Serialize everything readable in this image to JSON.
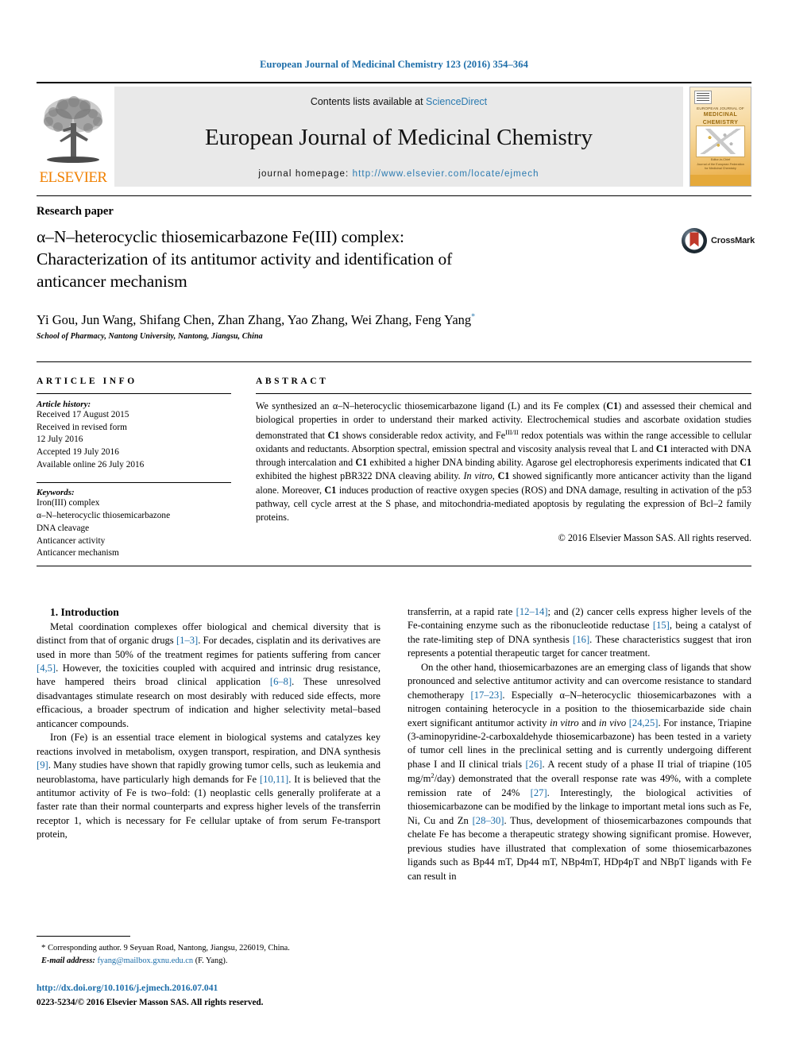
{
  "running_head": "European Journal of Medicinal Chemistry 123 (2016) 354–364",
  "masthead": {
    "publisher_name": "ELSEVIER",
    "contents_prefix": "Contents lists available at ",
    "contents_link": "ScienceDirect",
    "journal_name": "European Journal of Medicinal Chemistry",
    "homepage_prefix": "journal homepage: ",
    "homepage_link": "http://www.elsevier.com/locate/ejmech",
    "cover": {
      "title_top": "EUROPEAN JOURNAL OF",
      "title_main": "MEDICINAL CHEMISTRY",
      "foot_line1": "Editor-in-Chief",
      "foot_line2": "Journal of the European Federation",
      "foot_line3": "for Medicinal Chemistry"
    }
  },
  "article": {
    "type": "Research paper",
    "title_line1": "α–N–heterocyclic thiosemicarbazone Fe(III) complex:",
    "title_line2": "Characterization of its antitumor activity and identification of",
    "title_line3": "anticancer mechanism",
    "crossmark_label": "CrossMark",
    "authors": "Yi Gou, Jun Wang, Shifang Chen, Zhan Zhang, Yao Zhang, Wei Zhang, Feng Yang",
    "author_marker": "*",
    "affiliation": "School of Pharmacy, Nantong University, Nantong, Jiangsu, China"
  },
  "article_info": {
    "heading": "ARTICLE INFO",
    "history_label": "Article history:",
    "history": [
      "Received 17 August 2015",
      "Received in revised form",
      "12 July 2016",
      "Accepted 19 July 2016",
      "Available online 26 July 2016"
    ],
    "keywords_label": "Keywords:",
    "keywords": [
      "Iron(III) complex",
      "α–N–heterocyclic thiosemicarbazone",
      "DNA cleavage",
      "Anticancer activity",
      "Anticancer mechanism"
    ]
  },
  "abstract": {
    "heading": "ABSTRACT",
    "text_part1": "We synthesized an α–N–heterocyclic thiosemicarbazone ligand (L) and its Fe complex (",
    "bold_c1_a": "C1",
    "text_part2": ") and assessed their chemical and biological properties in order to understand their marked activity. Electrochemical studies and ascorbate oxidation studies demonstrated that ",
    "bold_c1_b": "C1",
    "text_part3": " shows considerable redox activity, and Fe",
    "sup_redox": "III/II",
    "text_part4": " redox potentials was within the range accessible to cellular oxidants and reductants. Absorption spectral, emission spectral and viscosity analysis reveal that L and ",
    "bold_c1_c": "C1",
    "text_part5": " interacted with DNA through intercalation and ",
    "bold_c1_d": "C1",
    "text_part6": " exhibited a higher DNA binding ability. Agarose gel electrophoresis experiments indicated that ",
    "bold_c1_e": "C1",
    "text_part7": " exhibited the highest pBR322 DNA cleaving ability. ",
    "italic_invitro": "In vitro",
    "text_part8": ", ",
    "bold_c1_f": "C1",
    "text_part9": " showed significantly more anticancer activity than the ligand alone. Moreover, ",
    "bold_c1_g": "C1",
    "text_part10": " induces production of reactive oxygen species (ROS) and DNA damage, resulting in activation of the p53 pathway, cell cycle arrest at the S phase, and mitochondria-mediated apoptosis by regulating the expression of Bcl–2 family proteins.",
    "copyright": "© 2016 Elsevier Masson SAS. All rights reserved."
  },
  "introduction": {
    "heading": "1. Introduction",
    "left_p1_a": "Metal coordination complexes offer biological and chemical diversity that is distinct from that of organic drugs ",
    "left_p1_ref1": "[1–3]",
    "left_p1_b": ". For decades, cisplatin and its derivatives are used in more than 50% of the treatment regimes for patients suffering from cancer ",
    "left_p1_ref2": "[4,5]",
    "left_p1_c": ". However, the toxicities coupled with acquired and intrinsic drug resistance, have hampered theirs broad clinical application ",
    "left_p1_ref3": "[6–8]",
    "left_p1_d": ". These unresolved disadvantages stimulate research on most desirably with reduced side effects, more efficacious, a broader spectrum of indication and higher selectivity metal–based anticancer compounds.",
    "left_p2_a": "Iron (Fe) is an essential trace element in biological systems and catalyzes key reactions involved in metabolism, oxygen transport, respiration, and DNA synthesis ",
    "left_p2_ref1": "[9]",
    "left_p2_b": ". Many studies have shown that rapidly growing tumor cells, such as leukemia and neuroblastoma, have particularly high demands for Fe ",
    "left_p2_ref2": "[10,11]",
    "left_p2_c": ". It is believed that the antitumor activity of Fe is two–fold: (1) neoplastic cells generally proliferate at a faster rate than their normal counterparts and express higher levels of the transferrin receptor 1, which is necessary for Fe cellular uptake of from serum Fe-transport protein,",
    "right_p1_a": "transferrin, at a rapid rate ",
    "right_p1_ref1": "[12–14]",
    "right_p1_b": "; and (2) cancer cells express higher levels of the Fe-containing enzyme such as the ribonucleotide reductase ",
    "right_p1_ref2": "[15]",
    "right_p1_c": ", being a catalyst of the rate-limiting step of DNA synthesis ",
    "right_p1_ref3": "[16]",
    "right_p1_d": ". These characteristics suggest that iron represents a potential therapeutic target for cancer treatment.",
    "right_p2_a": "On the other hand, thiosemicarbazones are an emerging class of ligands that show pronounced and selective antitumor activity and can overcome resistance to standard chemotherapy ",
    "right_p2_ref1": "[17–23]",
    "right_p2_b": ". Especially α–N–heterocyclic thiosemicarbazones with a nitrogen containing heterocycle in a position to the thiosemicarbazide side chain exert significant antitumor activity ",
    "right_p2_it1": "in vitro",
    "right_p2_c": " and ",
    "right_p2_it2": "in vivo",
    "right_p2_d": " ",
    "right_p2_ref2": "[24,25]",
    "right_p2_e": ". For instance, Triapine (3-aminopyridine-2-carboxaldehyde thiosemicarbazone) has been tested in a variety of tumor cell lines in the preclinical setting and is currently undergoing different phase I and II clinical trials ",
    "right_p2_ref3": "[26]",
    "right_p2_f": ". A recent study of a phase II trial of triapine (105 mg/m",
    "right_p2_sup": "2",
    "right_p2_g": "/day) demonstrated that the overall response rate was 49%, with a complete remission rate of 24% ",
    "right_p2_ref4": "[27]",
    "right_p2_h": ". Interestingly, the biological activities of thiosemicarbazone can be modified by the linkage to important metal ions such as Fe, Ni, Cu and Zn ",
    "right_p2_ref5": "[28–30]",
    "right_p2_i": ". Thus, development of thiosemicarbazones compounds that chelate Fe has become a therapeutic strategy showing significant promise. However, previous studies have illustrated that complexation of some thiosemicarbazones ligands such as Bp44 mT, Dp44 mT, NBp4mT, HDp4pT and NBpT ligands with Fe can result in"
  },
  "footnote": {
    "marker": "*",
    "corresponding": " Corresponding author. 9 Seyuan Road, Nantong, Jiangsu, 226019, China.",
    "email_label": "E-mail address:",
    "email": "fyang@mailbox.gxnu.edu.cn",
    "email_suffix": " (F. Yang)."
  },
  "footer": {
    "doi": "http://dx.doi.org/10.1016/j.ejmech.2016.07.041",
    "issn": "0223-5234/© 2016 Elsevier Masson SAS. All rights reserved."
  },
  "colors": {
    "link_blue": "#1b6ca8",
    "accent_orange": "#f08000",
    "band_gray": "#e9e9e9",
    "crossmark_red": "#c0392b"
  }
}
